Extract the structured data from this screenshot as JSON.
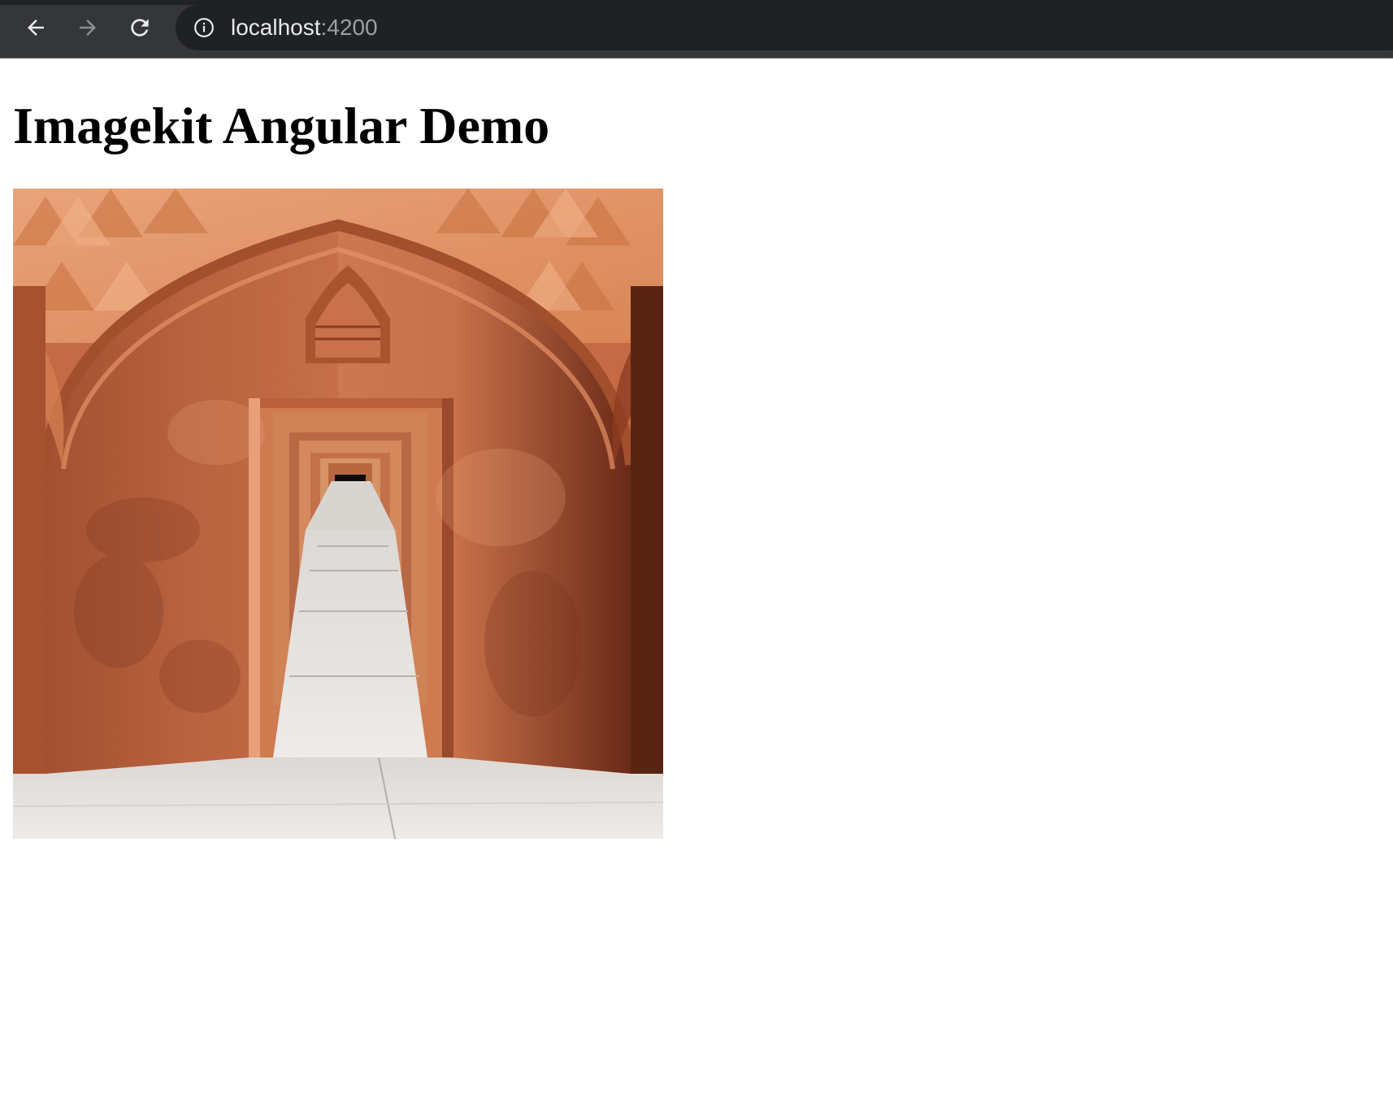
{
  "browser": {
    "url_host": "localhost",
    "url_port": ":4200",
    "icons": {
      "back": "arrow-left-icon",
      "forward": "arrow-right-icon",
      "reload": "reload-icon",
      "site_info": "info-icon"
    }
  },
  "page": {
    "heading": "Imagekit Angular Demo",
    "image": {
      "subject": "terracotta arched corridor with receding doorways"
    }
  },
  "colors": {
    "toolbar": "#35363a",
    "omnibox": "#202124",
    "url_text": "#e8eaed",
    "url_port": "#9aa0a6",
    "terracotta": "#c46a45"
  }
}
